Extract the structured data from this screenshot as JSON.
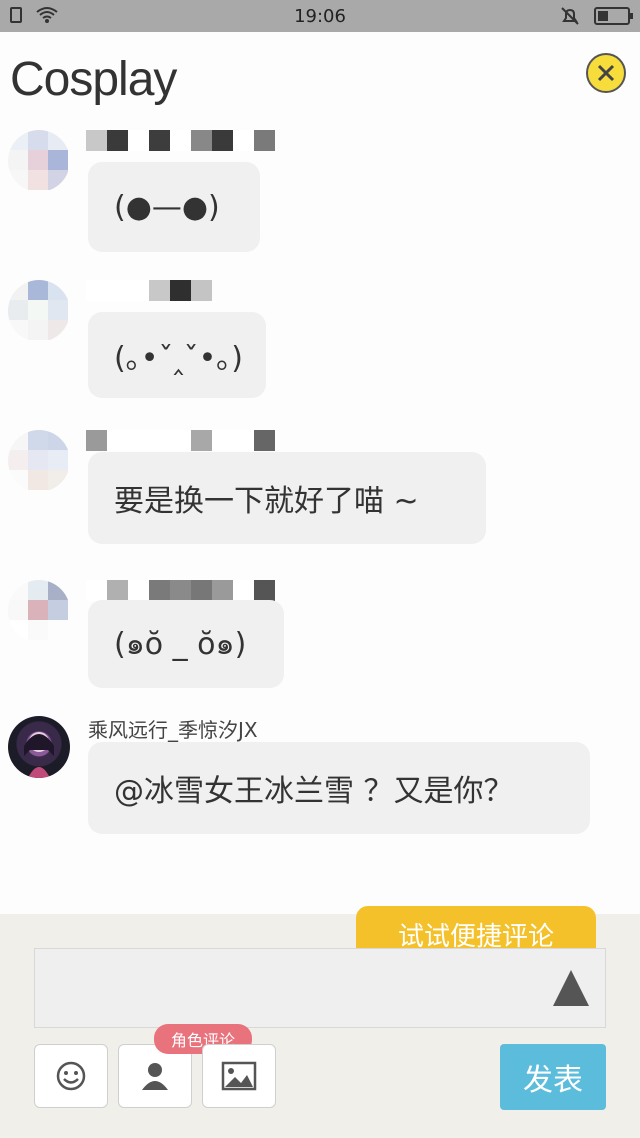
{
  "status_bar": {
    "time": "19:06"
  },
  "header": {
    "title": "Cosplay",
    "close_icon": "close-icon"
  },
  "messages": [
    {
      "name": "",
      "text": "(●—●)"
    },
    {
      "name": "",
      "text": "(｡•ˇ‸ˇ•｡)"
    },
    {
      "name": "",
      "text": "要是换一下就好了喵 ~"
    },
    {
      "name": "",
      "text": "(๑ŏ _ ŏ๑)"
    },
    {
      "name": "乘风远行_季惊汐JX",
      "text": "@冰雪女王冰兰雪 ？又是你？"
    }
  ],
  "composer": {
    "tip": "试试便捷评论",
    "input_value": "",
    "role_badge": "角色评论",
    "publish_label": "发表",
    "tools": [
      "emoji-icon",
      "person-icon",
      "image-icon"
    ]
  },
  "colors": {
    "accent_yellow": "#f4c12a",
    "publish_blue": "#5bbcdc",
    "badge_pink": "#e9737c"
  }
}
